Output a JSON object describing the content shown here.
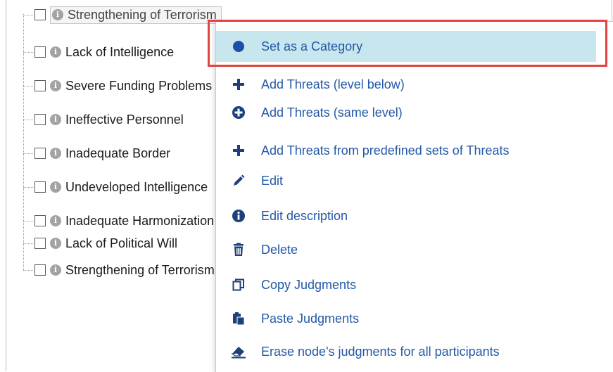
{
  "tree": {
    "items": [
      {
        "label": "Strengthening of Terrorism",
        "selected": true
      },
      {
        "label": "Lack of Intelligence"
      },
      {
        "label": "Severe Funding Problems"
      },
      {
        "label": "Ineffective Personnel"
      },
      {
        "label": "Inadequate Border"
      },
      {
        "label": "Undeveloped Intelligence"
      },
      {
        "label": "Inadequate Harmonization"
      },
      {
        "label": "Lack of Political Will"
      },
      {
        "label": "Strengthening of Terrorism"
      }
    ]
  },
  "menu": {
    "items": [
      {
        "label": "Set as a Category",
        "icon": "circle-icon"
      },
      {
        "label": "Add Threats (level below)",
        "icon": "plus-icon"
      },
      {
        "label": "Add Threats (same level)",
        "icon": "plus-circle-icon"
      },
      {
        "label": "Add Threats from predefined sets of Threats",
        "icon": "plus-icon"
      },
      {
        "label": "Edit",
        "icon": "pencil-icon"
      },
      {
        "label": "Edit description",
        "icon": "info-icon"
      },
      {
        "label": "Delete",
        "icon": "trash-icon"
      },
      {
        "label": "Copy Judgments",
        "icon": "copy-icon"
      },
      {
        "label": "Paste Judgments",
        "icon": "paste-icon"
      },
      {
        "label": "Erase node's judgments for all participants",
        "icon": "eraser-icon"
      }
    ]
  },
  "colors": {
    "menu_text": "#2458a6",
    "highlight_bg": "#c7e6ee",
    "annotation_border": "#e0443e"
  }
}
